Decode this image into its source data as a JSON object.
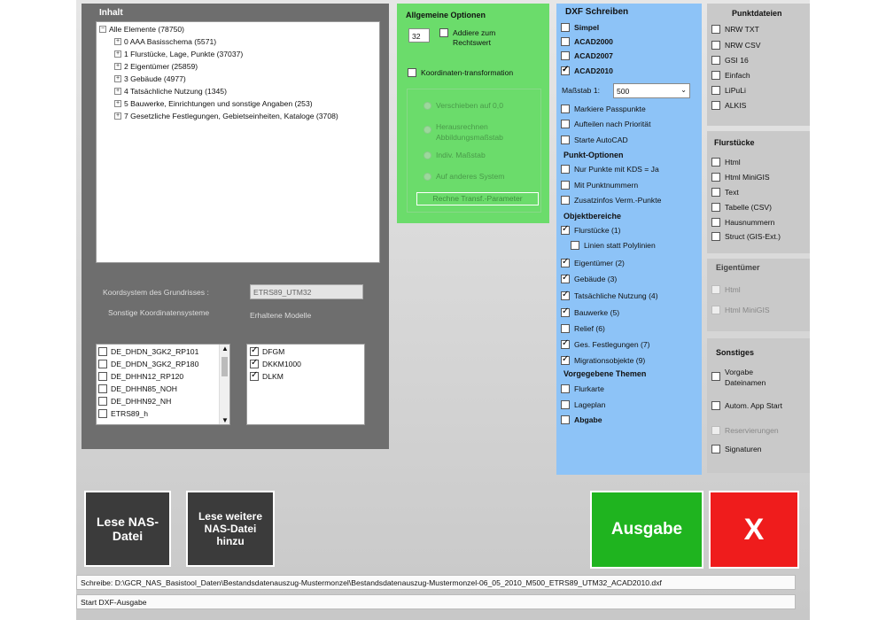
{
  "inhalt": {
    "title": "Inhalt",
    "root": "Alle Elemente (78750)",
    "items": [
      "0 AAA Basisschema (5571)",
      "1 Flurstücke, Lage, Punkte (37037)",
      "2 Eigentümer (25859)",
      "3 Gebäude (4977)",
      "4 Tatsächliche Nutzung (1345)",
      "5 Bauwerke, Einrichtungen und sonstige Angaben (253)",
      "7 Gesetzliche Festlegungen, Gebietseinheiten, Kataloge (3708)"
    ],
    "koord_label": "Koordsystem des Grundrisses :",
    "koord_value": "ETRS89_UTM32",
    "sonstige_label": "Sonstige Koordinatensysteme",
    "modelle_label": "Erhaltene Modelle",
    "koord_list": [
      "DE_DHDN_3GK2_RP101",
      "DE_DHDN_3GK2_RP180",
      "DE_DHHN12_RP120",
      "DE_DHHN85_NOH",
      "DE_DHHN92_NH",
      "ETRS89_h"
    ],
    "modelle": [
      {
        "label": "DFGM",
        "checked": true
      },
      {
        "label": "DKKM1000",
        "checked": true
      },
      {
        "label": "DLKM",
        "checked": true
      }
    ]
  },
  "allgemein": {
    "title": "Allgemeine Optionen",
    "addiere_value": "32",
    "addiere_label": "Addiere zum Rechtswert",
    "koordtrans_label": "Koordinaten-transformation",
    "radios": [
      "Verschieben auf 0,0",
      "Herausrechnen Abbildungsmaßstab",
      "Indiv. Maßstab",
      "Auf anderes System"
    ],
    "rechne_button": "Rechne Transf.-Parameter"
  },
  "dxf": {
    "title": "DXF Schreiben",
    "versions": [
      {
        "label": "Simpel",
        "checked": false
      },
      {
        "label": "ACAD2000",
        "checked": false
      },
      {
        "label": "ACAD2007",
        "checked": false
      },
      {
        "label": "ACAD2010",
        "checked": true
      }
    ],
    "massstab_label": "Maßstab 1:",
    "massstab_value": "500",
    "opts": [
      {
        "label": "Markiere Passpunkte",
        "checked": false
      },
      {
        "label": "Aufteilen nach Priorität",
        "checked": false
      },
      {
        "label": "Starte AutoCAD",
        "checked": false
      }
    ],
    "punkt_title": "Punkt-Optionen",
    "punkt_opts": [
      {
        "label": "Nur Punkte mit KDS = Ja",
        "checked": false
      },
      {
        "label": "Mit Punktnummern",
        "checked": false
      },
      {
        "label": "Zusatzinfos Verm.-Punkte",
        "checked": false
      }
    ],
    "objekt_title": "Objektbereiche",
    "flurstuecke": "Flurstücke (1)",
    "linien": "Linien statt Polylinien",
    "objekt_opts": [
      {
        "label": "Eigentümer (2)",
        "checked": true
      },
      {
        "label": "Gebäude (3)",
        "checked": true
      },
      {
        "label": "Tatsächliche Nutzung (4)",
        "checked": true
      },
      {
        "label": "Bauwerke (5)",
        "checked": true
      },
      {
        "label": "Relief (6)",
        "checked": false
      },
      {
        "label": "Ges. Festlegungen (7)",
        "checked": true
      },
      {
        "label": "Migrationsobjekte (9)",
        "checked": true
      }
    ],
    "themen_title": "Vorgegebene Themen",
    "themen": [
      {
        "label": "Flurkarte",
        "checked": false
      },
      {
        "label": "Lageplan",
        "checked": false
      }
    ],
    "abgabe": "Abgabe"
  },
  "punktdateien": {
    "title": "Punktdateien",
    "items": [
      "NRW TXT",
      "NRW CSV",
      "GSI 16",
      "Einfach",
      "LiPuLi",
      "ALKIS"
    ]
  },
  "flurstuecke": {
    "title": "Flurstücke",
    "items": [
      "Html",
      "Html MiniGIS",
      "Text",
      "Tabelle (CSV)",
      "Hausnummern",
      "Struct (GIS-Ext.)"
    ]
  },
  "eigentuemer": {
    "title": "Eigentümer",
    "items": [
      "Html",
      "Html MiniGIS"
    ]
  },
  "sonstiges": {
    "title": "Sonstiges",
    "items": [
      "Vorgabe Dateinamen",
      "Autom. App Start",
      "Reservierungen",
      "Signaturen"
    ]
  },
  "buttons": {
    "lese": "Lese NAS-Datei",
    "lese_weitere": "Lese weitere NAS-Datei hinzu",
    "ausgabe": "Ausgabe",
    "close": "X"
  },
  "status": {
    "line1": "Schreibe: D:\\GCR_NAS_Basistool_Daten\\Bestandsdatenauszug-Mustermonzel\\Bestandsdatenauszug-Mustermonzel-06_05_2010_M500_ETRS89_UTM32_ACAD2010.dxf",
    "line2": "Start DXF-Ausgabe"
  },
  "colors": {
    "green_panel": "#6bdc6b",
    "blue_panel": "#8dc3f7",
    "ausgabe": "#1fb41f",
    "close": "#ef1c1c"
  }
}
